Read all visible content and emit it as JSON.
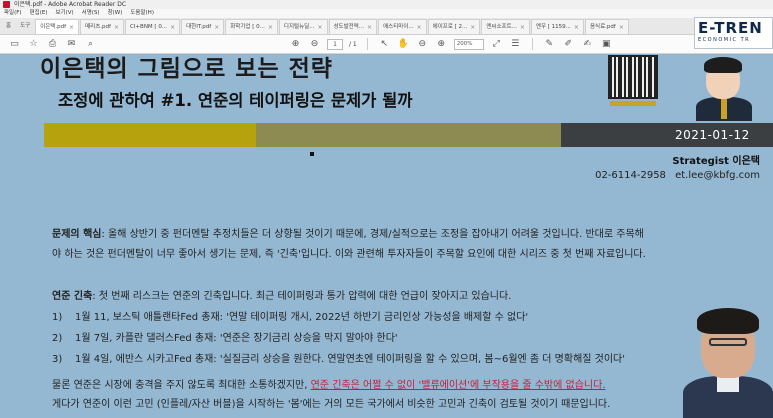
{
  "window": {
    "title": "이은택.pdf - Adobe Acrobat Reader DC"
  },
  "menu": [
    "파일(F)",
    "편집(E)",
    "보기(V)",
    "서명(S)",
    "창(W)",
    "도움말(H)"
  ],
  "tabs": [
    {
      "label": "홈",
      "type": "home"
    },
    {
      "label": "도구",
      "type": "home"
    },
    {
      "label": "이은택.pdf",
      "type": "active"
    },
    {
      "label": "메리츠.pdf",
      "type": "normal"
    },
    {
      "label": "CI+BNM [ 0...",
      "type": "normal"
    },
    {
      "label": "대한IT.pdf",
      "type": "normal"
    },
    {
      "label": "화학기업 [ 0...",
      "type": "normal"
    },
    {
      "label": "디지털뉴딜...",
      "type": "normal"
    },
    {
      "label": "성도발전력...",
      "type": "normal"
    },
    {
      "label": "애스티마이...",
      "type": "normal"
    },
    {
      "label": "에이프로 [ 2...",
      "type": "normal"
    },
    {
      "label": "엔씨소프트...",
      "type": "normal"
    },
    {
      "label": "엔우 [ 1159...",
      "type": "normal"
    },
    {
      "label": "음식료.pdf",
      "type": "normal"
    }
  ],
  "toolbar": {
    "page_current": "1",
    "page_total": "/ 1",
    "zoom": "200%"
  },
  "logo": {
    "big": "E-TREN",
    "small": "ECONOMIC TR"
  },
  "document": {
    "cut_title": "이은택의  그림으로 보는  전략",
    "title": "조정에 관하여 #1. 연준의 테이퍼링은 문제가 될까",
    "date": "2021-01-12",
    "author": "Strategist 이은택",
    "phone": "02-6114-2958",
    "email": "et.lee@kbfg.com",
    "p1_label": "문제의 핵심",
    "p1_line1": ": 올해 상반기 중 펀더멘탈 추정치들은 더 상향될 것이기 때문에, 경제/실적으로는 조정을 잡아내기 어려울 것입니다. 반대로 주목해",
    "p1_line2": "야 하는 것은 펀더멘탈이 너무 좋아서 생기는 문제, 즉 '긴축'입니다. 이와 관련해 투자자들이 주목할 요인에 대한 시리즈 중 첫 번째 자료입니다.",
    "p2_label": "연준 긴축",
    "p2_line1": ": 첫 번째 리스크는 연준의 긴축입니다. 최근 테이퍼링과 통가 압력에 대한 언급이 잦아지고 있습니다.",
    "items": [
      {
        "num": "1)",
        "date": "1월 11, 보스틱 애틀랜타Fed 총재:",
        "quote": " '연말 테이퍼링 개시, 2022년 하반기 금리인상 가능성을 배제할 수 없다'"
      },
      {
        "num": "2)",
        "date": "1월 7일, 카플란 댈러스Fed 총재:",
        "quote": " '연준은 장기금리 상승을 막지 말아야 한다'"
      },
      {
        "num": "3)",
        "date": "1월 4일, 에반스 시카고Fed 총재:",
        "quote": " '실질금리 상승을 원한다. 연말연초엔 테이퍼링을 할 수 있으며, 봄~6월엔 좀 더 명확해질 것이다'"
      }
    ],
    "p3_line1_a": "물론 연준은 시장에 충격을 주지 않도록 최대한 소통하겠지만, ",
    "p3_line1_b": "연준 긴축은 어쩔 수 없이 '밸류에이션'에 부작용을 줄 수밖에 없습니다.",
    "p3_line2": "게다가 연준이 이런 고민 (인플레/자산 버블)을 시작하는 '봄'에는 거의 모든 국가에서 비슷한 고민과 긴축이 검토될 것이기 때문입니다."
  }
}
